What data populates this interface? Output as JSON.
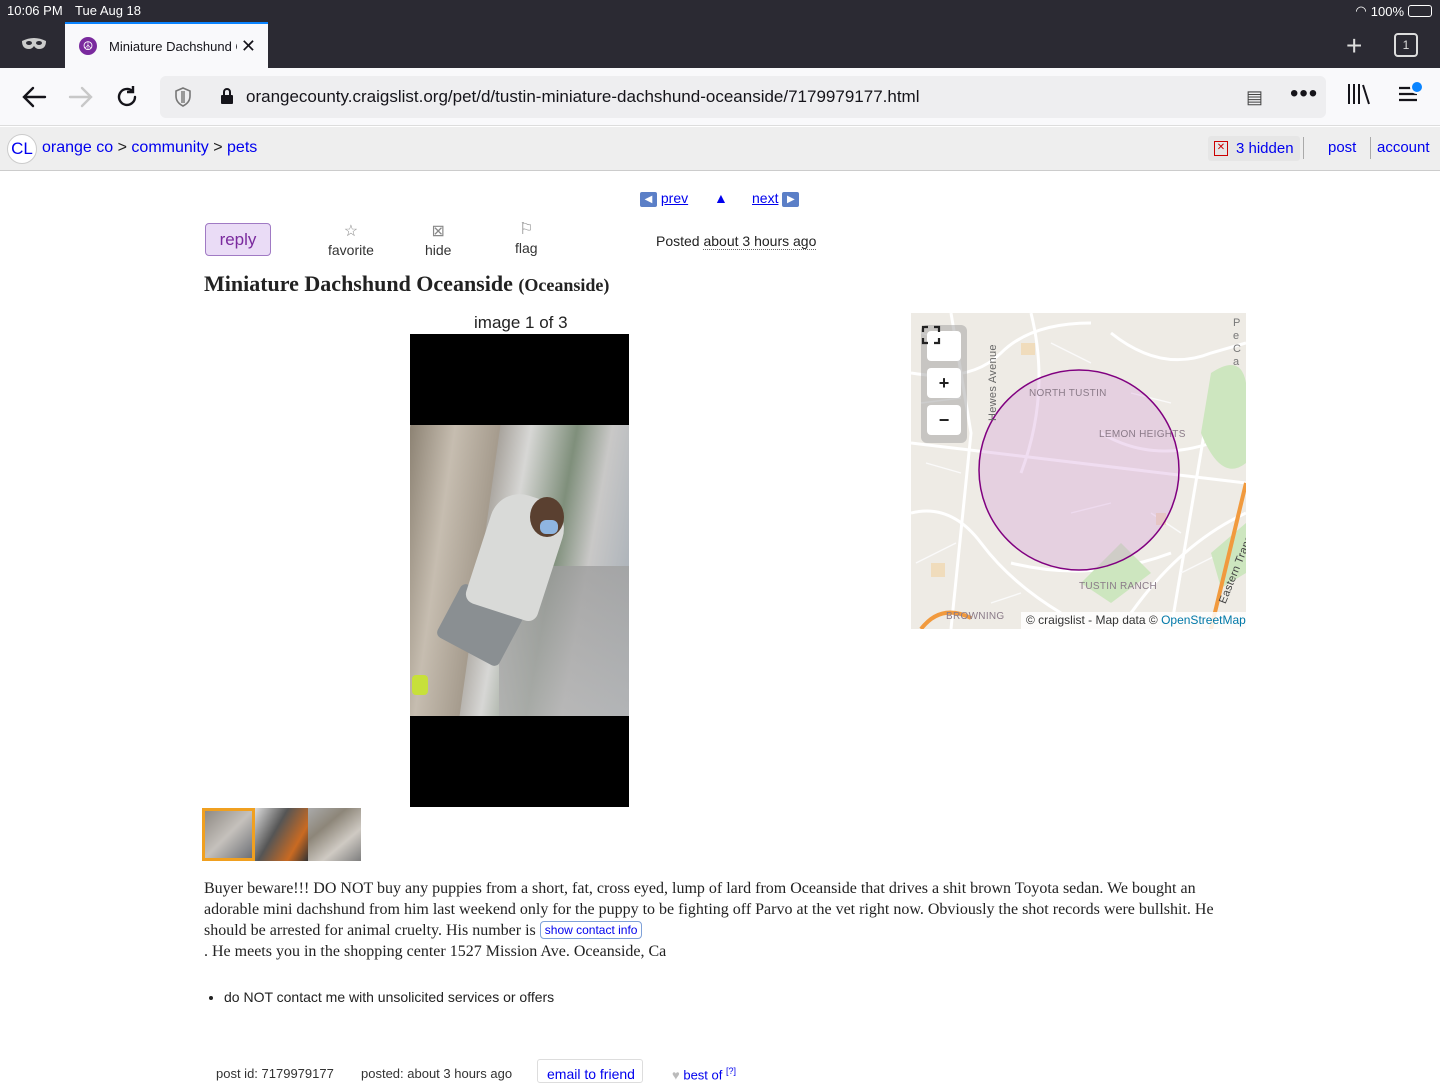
{
  "status_bar": {
    "time": "10:06 PM",
    "date": "Tue Aug 18",
    "battery": "100%"
  },
  "tabs": [
    {
      "title": "Miniature Dachshund Oceanside",
      "active": true
    }
  ],
  "tab_count": "1",
  "url": "orangecounty.craigslist.org/pet/d/tustin-miniature-dachshund-oceanside/7179979177.html",
  "header": {
    "logo": "CL",
    "breadcrumbs": {
      "area": "orange co",
      "sep1": ">",
      "category": "community",
      "sep2": ">",
      "subcategory": "pets"
    },
    "hidden_label": "3 hidden",
    "post_label": "post",
    "account_label": "account"
  },
  "post_nav": {
    "prev": "prev",
    "up": "▲",
    "next": "next"
  },
  "actions": {
    "reply": "reply",
    "favorite": "favorite",
    "hide": "hide",
    "flag": "flag"
  },
  "posted": {
    "label": "Posted",
    "time": "about 3 hours ago"
  },
  "post": {
    "title": "Miniature Dachshund Oceanside",
    "location": "(Oceanside)",
    "image_counter": "image 1 of 3",
    "body_part1": "Buyer beware!!! DO NOT buy any puppies from a short, fat, cross eyed, lump of lard from Oceanside that drives a shit brown Toyota sedan. We bought an adorable mini dachshund from him last weekend only for the puppy to be fighting off Parvo at the vet right now. Obviously the shot records were bullshit. He should be arrested for animal cruelty. His number is",
    "contact_button": "show contact info",
    "body_part2": ". He meets you in the shopping center 1527 Mission Ave. Oceanside, Ca",
    "notice": "do NOT contact me with unsolicited services or offers"
  },
  "map": {
    "labels": {
      "street": "Hewes Avenue",
      "north_tustin": "NORTH TUSTIN",
      "lemon_heights": "LEMON HEIGHTS",
      "tustin_ranch": "TUSTIN RANCH",
      "browning": "BROWNING",
      "transport": "Eastern Transportation",
      "corner": "Pe Ca Re F"
    },
    "attribution": "© craigslist - Map data ©",
    "attribution_link": "OpenStreetMap"
  },
  "footer": {
    "post_id": "post id: 7179979177",
    "posted": "posted: about 3 hours ago",
    "email_friend": "email to friend",
    "best_of": "best of",
    "best_of_sup": "[?]"
  },
  "colors": {
    "accent": "#0a84ff",
    "link": "#0000ee",
    "reply_bg": "#eadcf6",
    "map_circle": "#800080"
  }
}
